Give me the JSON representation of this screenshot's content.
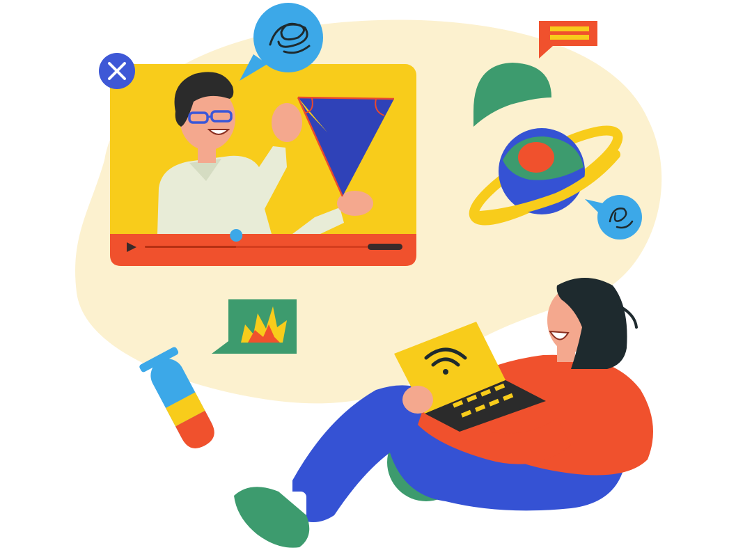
{
  "colors": {
    "background": "#ffffff",
    "blob": "#fcf1cf",
    "video_screen": "#f8cc1b",
    "video_bar": "#f0512d",
    "teacher_skin": "#f4a88e",
    "teacher_hair": "#2b2b2b",
    "teacher_shirt": "#e8ecd7",
    "glasses": "#3a57d8",
    "triangle_fill": "#2f42b8",
    "triangle_lines": "#e8492f",
    "close_button": "#3e58d6",
    "bubble_blue": "#3ca8e8",
    "flag_red": "#f0512d",
    "flag_yellow": "#f8cc1b",
    "dome_green": "#3d9b6e",
    "planet_blue": "#3552d4",
    "planet_red": "#f0512d",
    "planet_ring": "#f8cc1b",
    "explosion_box": "#3d9b6e",
    "tube_red": "#f0512d",
    "tube_yellow": "#f8cc1b",
    "tube_blue": "#3ca8e8",
    "student_shirt": "#f0512d",
    "student_pants": "#3552d4",
    "student_hair": "#1e2a2e",
    "student_skin": "#f4a88e",
    "laptop_yellow": "#f8cc1b",
    "shoes": "#3d9b6e"
  },
  "icons": [
    "close-icon",
    "scribble-bubble-icon",
    "play-icon",
    "flag-icon",
    "dome-icon",
    "planet-icon",
    "small-scribble-bubble-icon",
    "explosion-icon",
    "test-tube-icon",
    "wifi-icon"
  ],
  "video": {
    "progress_fraction": 0.41
  }
}
